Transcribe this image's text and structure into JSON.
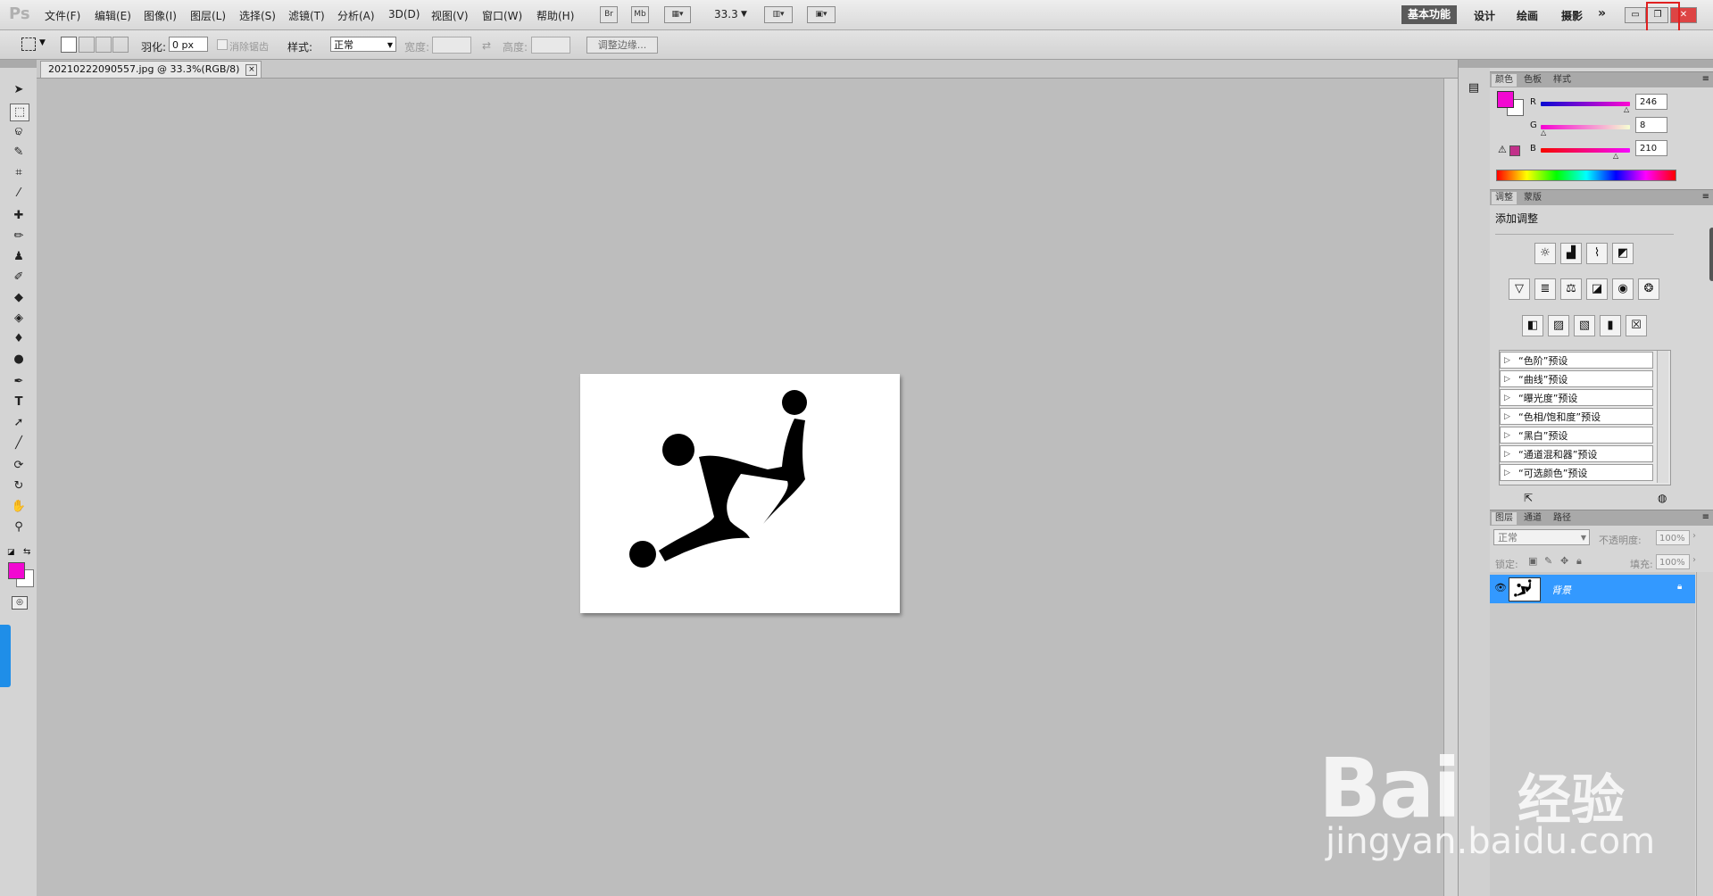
{
  "app": {
    "logo": "Ps"
  },
  "menu": [
    "文件(F)",
    "编辑(E)",
    "图像(I)",
    "图层(L)",
    "选择(S)",
    "滤镜(T)",
    "分析(A)",
    "3D(D)",
    "视图(V)",
    "窗口(W)",
    "帮助(H)"
  ],
  "appbar": {
    "bridge": "Br",
    "mini_bridge": "Mb",
    "zoom": "33.3"
  },
  "workspaces": {
    "active": "基本功能",
    "items": [
      "设计",
      "绘画",
      "摄影"
    ],
    "more": "»"
  },
  "options": {
    "feather_label": "羽化:",
    "feather_value": "0 px",
    "antialias_label": "消除锯齿",
    "style_label": "样式:",
    "style_value": "正常",
    "width_label": "宽度:",
    "height_label": "高度:",
    "refine_edge": "调整边缘..."
  },
  "document": {
    "tab_title": "20210222090557.jpg @ 33.3%(RGB/8)",
    "close": "×"
  },
  "colors": {
    "foreground": "#f208d2",
    "background": "#ffffff",
    "highlight": "#e02020",
    "layer_selected": "#3399ff"
  },
  "color_panel": {
    "tabs": [
      "颜色",
      "色板",
      "样式"
    ],
    "r_label": "R",
    "g_label": "G",
    "b_label": "B",
    "r": "246",
    "g": "8",
    "b": "210"
  },
  "adjust_panel": {
    "tabs": [
      "调整",
      "蒙版"
    ],
    "title": "添加调整",
    "presets": [
      "“色阶”预设",
      "“曲线”预设",
      "“曝光度”预设",
      "“色相/饱和度”预设",
      "“黑白”预设",
      "“通道混和器”预设",
      "“可选颜色”预设"
    ]
  },
  "layers_panel": {
    "tabs": [
      "图层",
      "通道",
      "路径"
    ],
    "blend_mode": "正常",
    "opacity_label": "不透明度:",
    "opacity": "100%",
    "lock_label": "锁定:",
    "fill_label": "填充:",
    "fill": "100%",
    "layer_name": "背景"
  },
  "watermark": {
    "logo": "Bai",
    "logo_cn": "经验",
    "sub": "jingyan.baidu.com"
  }
}
